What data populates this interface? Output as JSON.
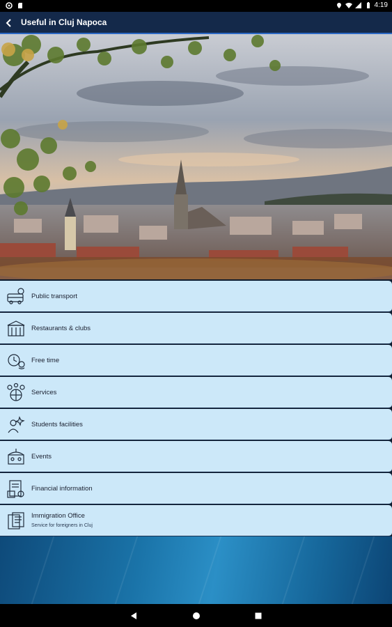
{
  "status_bar": {
    "time": "4:19"
  },
  "app_bar": {
    "title": "Useful in Cluj Napoca"
  },
  "menu": [
    {
      "label": "Public transport",
      "icon": "bus-icon"
    },
    {
      "label": "Restaurants & clubs",
      "icon": "restaurant-icon"
    },
    {
      "label": "Free time",
      "icon": "free-time-icon"
    },
    {
      "label": "Services",
      "icon": "services-icon"
    },
    {
      "label": "Students facilities",
      "icon": "student-icon"
    },
    {
      "label": "Events",
      "icon": "events-icon"
    },
    {
      "label": "Financial information",
      "icon": "financial-icon"
    },
    {
      "label": "Immigration Office",
      "sublabel": "Service for foreigners in Cluj",
      "icon": "immigration-icon"
    }
  ],
  "colors": {
    "app_bar": "#14294a",
    "menu_bg": "#cce8f9",
    "accent": "#2b68c4"
  }
}
